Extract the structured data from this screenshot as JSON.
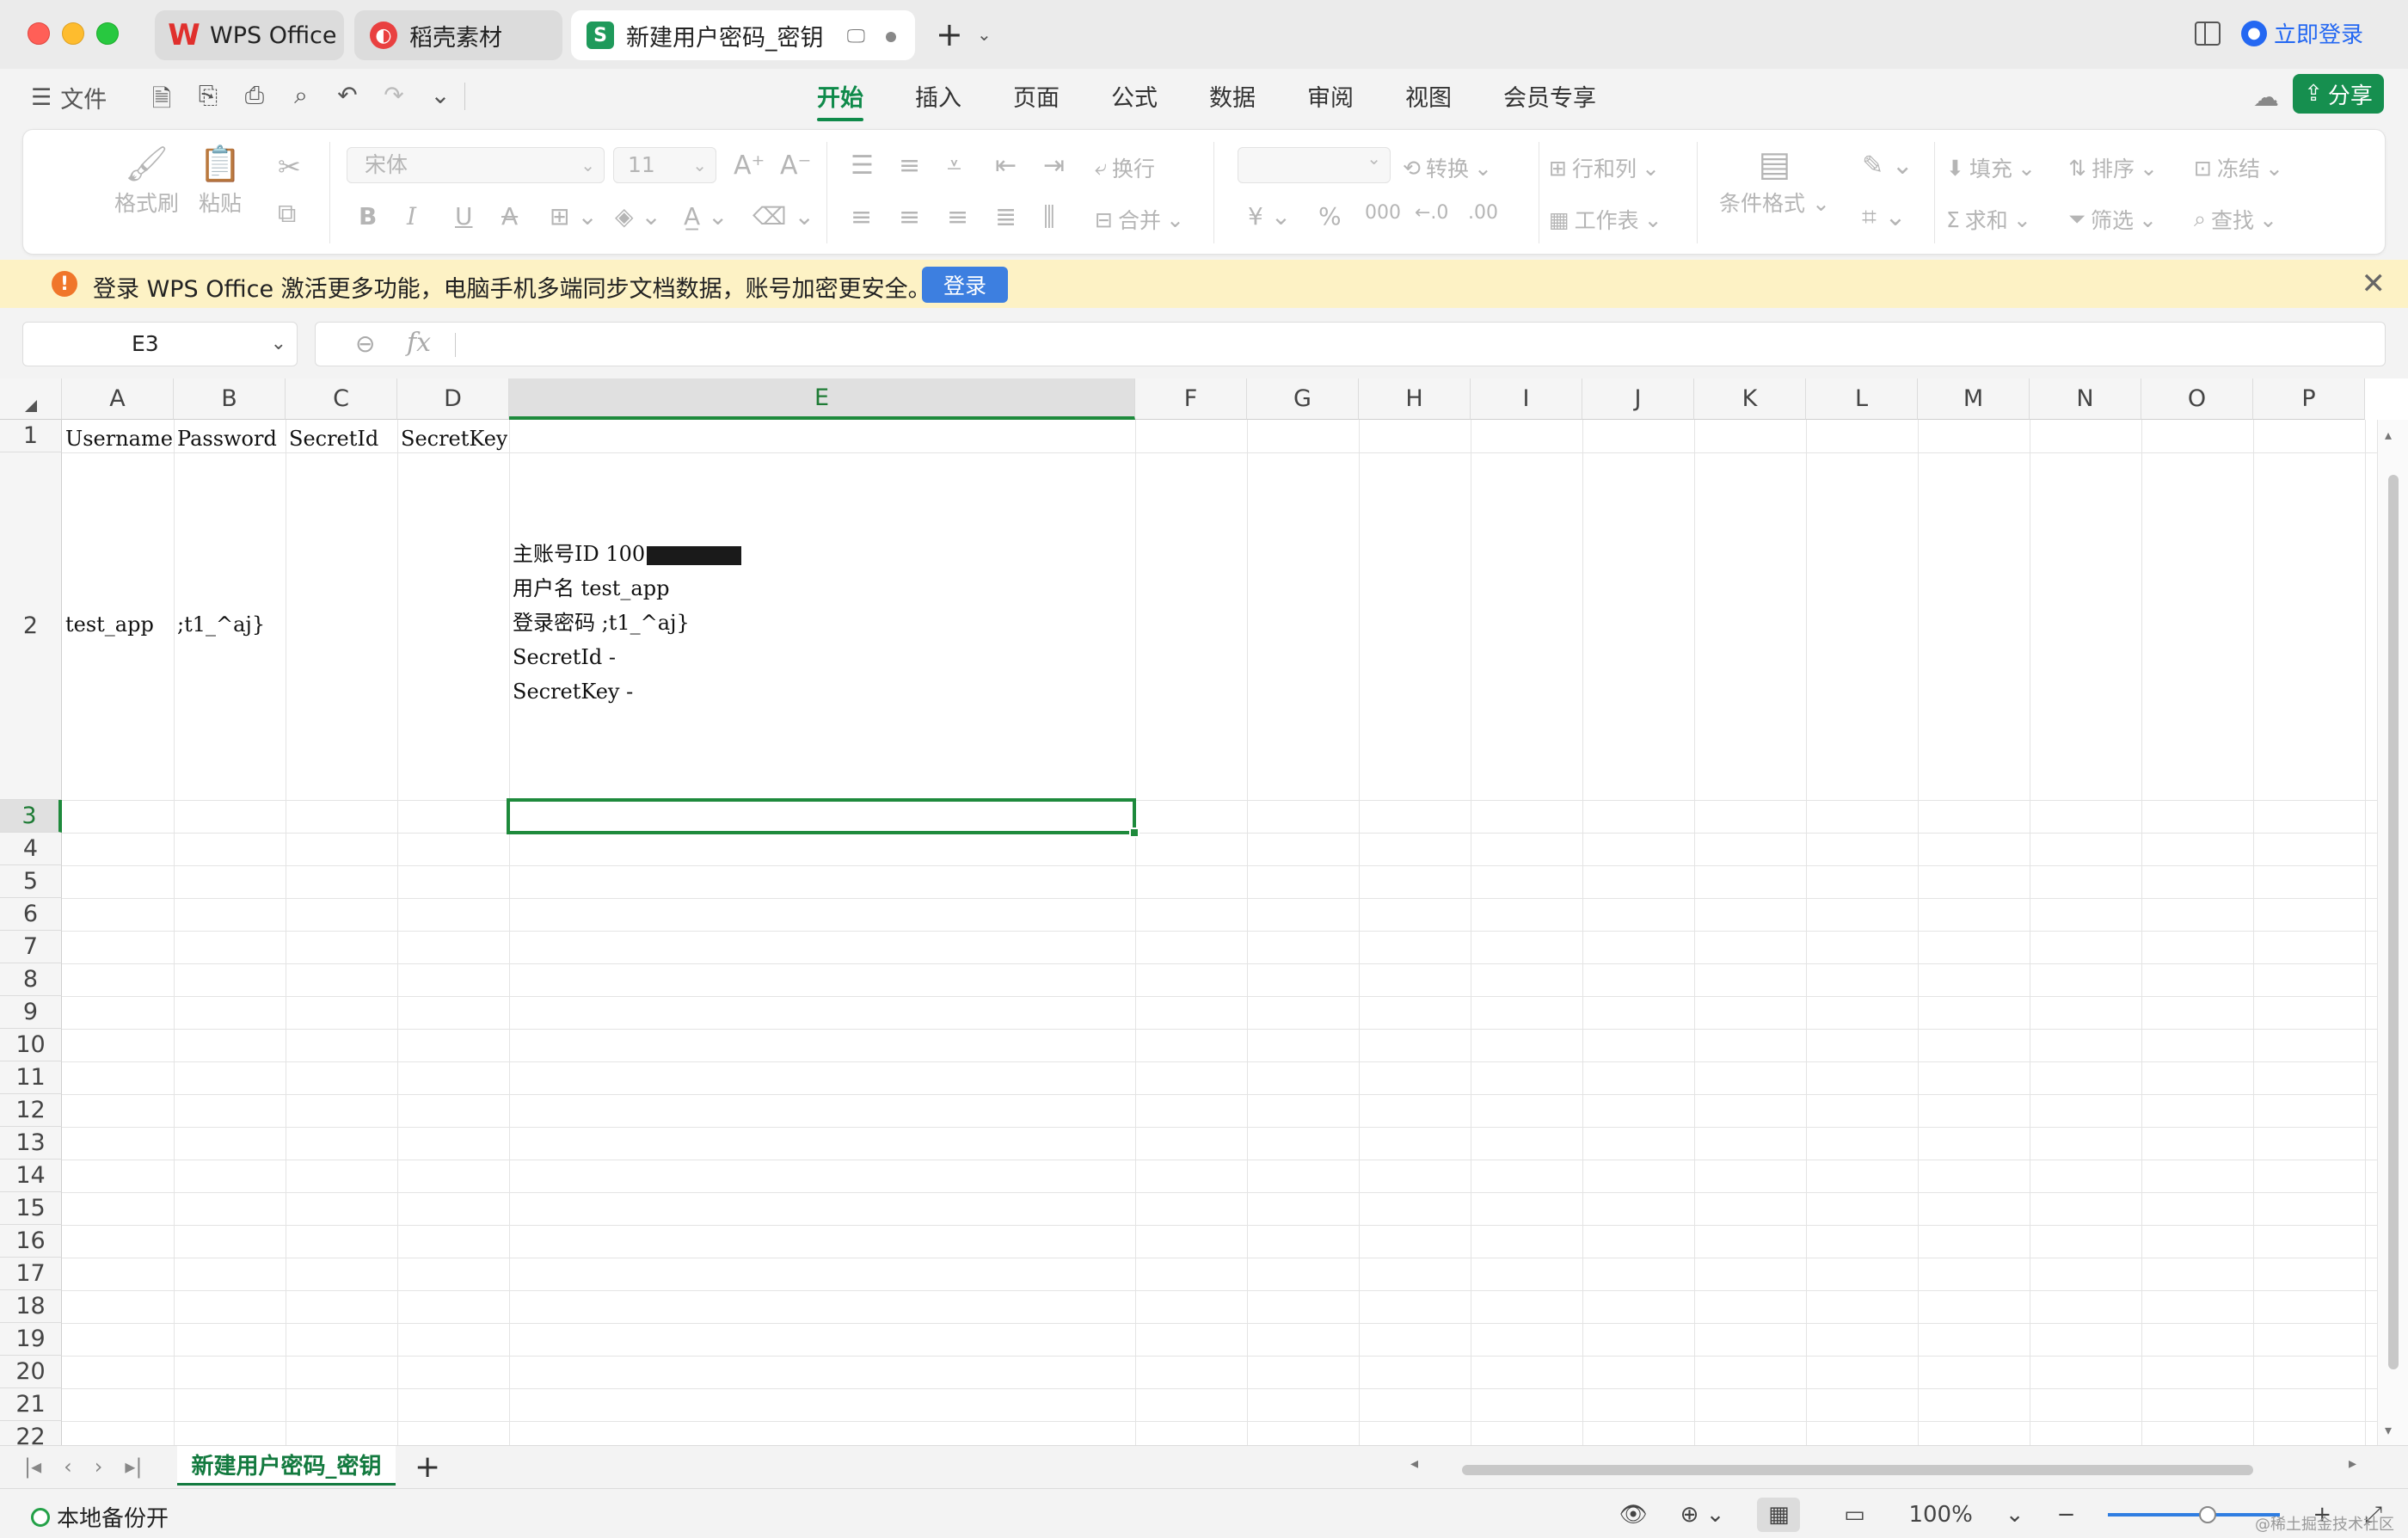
{
  "titlebar": {
    "tabs": [
      {
        "label": "WPS Office",
        "icon": "wps-logo-icon"
      },
      {
        "label": "稻壳素材",
        "icon": "daoke-icon"
      },
      {
        "label": "新建用户密码_密钥",
        "icon": "spreadsheet-icon",
        "badge": "S"
      }
    ],
    "login_label": "立即登录"
  },
  "menubar": {
    "file_label": "文件",
    "tabs": [
      "开始",
      "插入",
      "页面",
      "公式",
      "数据",
      "审阅",
      "视图",
      "会员专享"
    ],
    "active_tab": "开始",
    "share_label": "分享"
  },
  "ribbon": {
    "format_painter": "格式刷",
    "paste": "粘贴",
    "font_name": "宋体",
    "font_size": "11",
    "wrap": "换行",
    "merge": "合并",
    "convert": "转换",
    "row_col": "行和列",
    "worksheet": "工作表",
    "cond_format": "条件格式",
    "fill": "填充",
    "sort": "排序",
    "freeze": "冻结",
    "sum": "求和",
    "filter": "筛选",
    "find": "查找"
  },
  "notification": {
    "text": "登录 WPS Office 激活更多功能，电脑手机多端同步文档数据，账号加密更安全。",
    "button": "登录"
  },
  "formula_bar": {
    "cell_ref": "E3",
    "fx": "fx",
    "value": ""
  },
  "sheet": {
    "columns": [
      "A",
      "B",
      "C",
      "D",
      "E",
      "F",
      "G",
      "H",
      "I",
      "J",
      "K",
      "L",
      "M",
      "N",
      "O",
      "P"
    ],
    "selected_column": "E",
    "rows": [
      "1",
      "2",
      "3",
      "4",
      "5",
      "6",
      "7",
      "8",
      "9",
      "10",
      "11",
      "12",
      "13",
      "14",
      "15",
      "16",
      "17",
      "18",
      "19",
      "20",
      "21",
      "22"
    ],
    "selected_row": "3",
    "headers": {
      "A1": "Username",
      "B1": "Password",
      "C1": "SecretId",
      "D1": "SecretKey"
    },
    "row2": {
      "A2": "test_app",
      "B2": ";t1_^aj}"
    },
    "e2_lines": [
      "主账号ID 100",
      "用户名 test_app",
      "登录密码 ;t1_^aj}",
      "SecretId -",
      "SecretKey -"
    ]
  },
  "sheet_tabs": {
    "active": "新建用户密码_密钥"
  },
  "status": {
    "backup": "本地备份开",
    "zoom": "100%"
  },
  "watermark": "@稀土掘金技术社区"
}
